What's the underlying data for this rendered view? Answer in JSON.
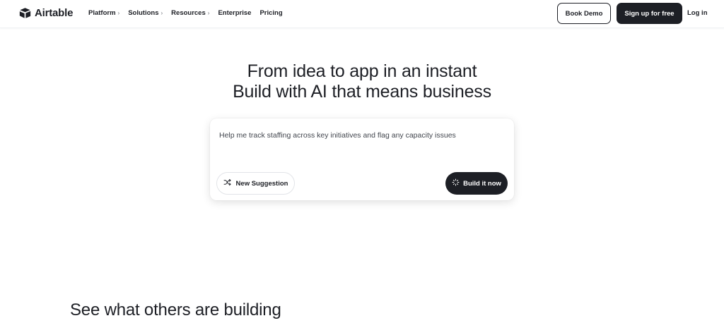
{
  "brand": {
    "name": "Airtable"
  },
  "nav": {
    "items": [
      {
        "label": "Platform",
        "has_dropdown": true
      },
      {
        "label": "Solutions",
        "has_dropdown": true
      },
      {
        "label": "Resources",
        "has_dropdown": true
      },
      {
        "label": "Enterprise",
        "has_dropdown": false
      },
      {
        "label": "Pricing",
        "has_dropdown": false
      }
    ],
    "chevron": "›",
    "book_demo_label": "Book Demo",
    "signup_label": "Sign up for free",
    "login_label": "Log in"
  },
  "hero": {
    "line1": "From idea to app in an instant",
    "line2": "Build with AI that means business"
  },
  "prompt": {
    "value": "Help me track staffing across key initiatives and flag any capacity issues",
    "new_suggestion_label": "New Suggestion",
    "new_suggestion_icon": "shuffle-icon",
    "build_label": "Build it now",
    "build_icon": "sparkle-loader-icon"
  },
  "section": {
    "title": "See what others are building"
  },
  "colors": {
    "primary_dark": "#1d1f25",
    "background": "#ffffff",
    "border_light": "#e2e4e8"
  }
}
